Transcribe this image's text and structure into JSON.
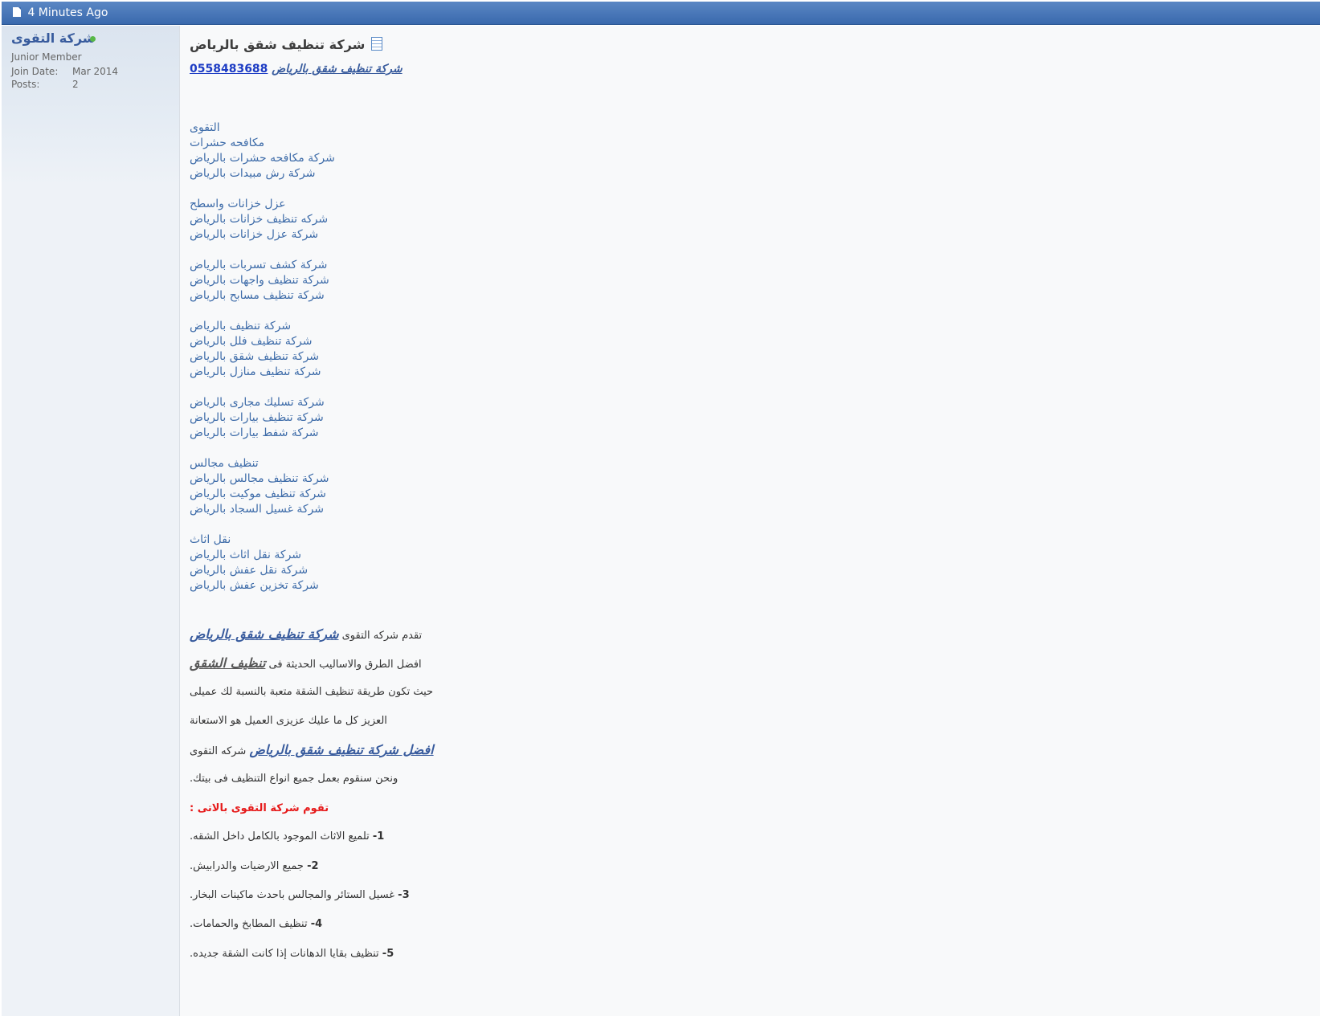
{
  "header": {
    "post_time": "4 Minutes Ago"
  },
  "user": {
    "name": "شركة التقوى",
    "title": "Junior Member",
    "join_label": "Join Date:",
    "join_value": "Mar 2014",
    "posts_label": "Posts:",
    "posts_value": "2"
  },
  "post": {
    "title": "شركة تنظيف شقق بالرياض",
    "first_line_phone": "0558483688",
    "first_line_link": "شركة تنظيف شقق بالرياض",
    "links": [
      [
        "التقوى",
        "مكافحه حشرات",
        "شركة مكافحه حشرات بالرياض",
        "شركة رش مبيدات بالرياض"
      ],
      [
        "عزل خزانات واسطح",
        "شركه تنظيف خزانات بالرياض",
        "شركة عزل خزانات بالرياض"
      ],
      [
        "شركة كشف تسربات بالرياض",
        "شركة تنظيف واجهات بالرياض",
        "شركة تنظيف مسابح بالرياض"
      ],
      [
        "شركة تنظيف بالرياض",
        "شركة تنظيف فلل بالرياض",
        "شركة تنظيف شقق بالرياض",
        "شركة تنظيف منازل بالرياض"
      ],
      [
        "شركة تسليك مجارى بالرياض",
        "شركة تنظيف بيارات بالرياض",
        "شركة شفط بيارات بالرياض"
      ],
      [
        "تنظيف مجالس",
        "شركة تنظيف مجالس بالرياض",
        "شركة تنظيف موكيت بالرياض",
        "شركة غسيل السجاد بالرياض"
      ],
      [
        "نقل اثاث",
        "شركة نقل اثاث بالرياض",
        "شركة نقل عفش بالرياض",
        "شركة تخزين عفش بالرياض"
      ]
    ],
    "para1_text": "تقدم شركه التقوى",
    "para1_link": "شركة تنظيف شقق بالرياض",
    "para2_text": "افضل الطرق والاساليب الحديثة فى",
    "para2_link": "تنظيف الشقق",
    "para3": "حيث تكون طريقة تنظيف الشقة متعبة بالنسبة لك عميلى",
    "para4": "العزيز كل ما عليك عزيزى العميل هو الاستعانة",
    "para5_link": "افضل شركة تنظيف شقق بالرياض",
    "para5_text": "شركه التقوى",
    "para6": "ونحن سنقوم بعمل جميع انواع التنظيف فى بيتك.",
    "red_line": "تقوم شركة التقوى بالاتى :",
    "services": [
      {
        "num": "1-",
        "text": "تلميع الاثاث الموجود بالكامل داخل الشقه."
      },
      {
        "num": "2-",
        "text": "جميع الارضيات والدرابيش."
      },
      {
        "num": "3-",
        "text": "غسيل الستائر والمجالس باحدث ماكينات البخار."
      },
      {
        "num": "4-",
        "text": "تنظيف المطابخ والحمامات."
      },
      {
        "num": "5-",
        "text": "تنظيف بقايا الدهانات إذا كانت الشقة جديده."
      }
    ]
  },
  "colors": {
    "header_blue": "#3a69ad",
    "link_blue": "#3e6ca9",
    "red": "#e61a1a",
    "online_green": "#57b847"
  }
}
